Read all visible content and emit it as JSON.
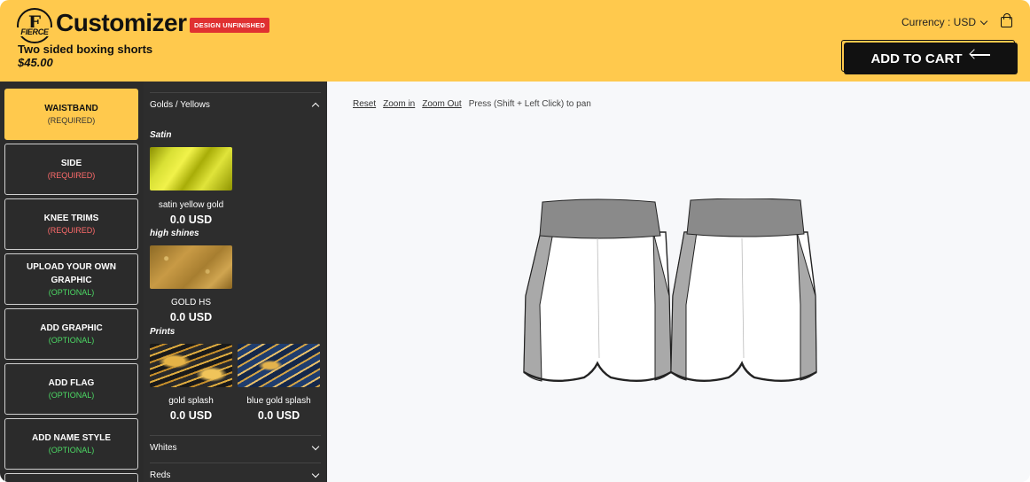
{
  "header": {
    "logo_text": "FIERCE",
    "title": "Customizer",
    "badge": "DESIGN UNFINISHED",
    "product_name": "Two sided boxing shorts",
    "price": "$45.00",
    "currency_label": "Currency : USD",
    "add_to_cart": "ADD TO CART",
    "accent_color": "#ffc94d"
  },
  "steps": [
    {
      "name": "WAISTBAND",
      "status": "(REQUIRED)",
      "active": true
    },
    {
      "name": "SIDE",
      "status": "(REQUIRED)",
      "active": false
    },
    {
      "name": "KNEE TRIMS",
      "status": "(REQUIRED)",
      "active": false
    },
    {
      "name": "UPLOAD YOUR OWN GRAPHIC",
      "status": "(OPTIONAL)",
      "active": false
    },
    {
      "name": "ADD GRAPHIC",
      "status": "(OPTIONAL)",
      "active": false
    },
    {
      "name": "ADD FLAG",
      "status": "(OPTIONAL)",
      "active": false
    },
    {
      "name": "ADD NAME STYLE",
      "status": "(OPTIONAL)",
      "active": false
    }
  ],
  "palette": {
    "groups": [
      {
        "label": "Golds / Yellows",
        "expanded": true
      },
      {
        "label": "Whites",
        "expanded": false
      },
      {
        "label": "Reds",
        "expanded": false
      }
    ],
    "categories": {
      "satin": "Satin",
      "high_shines": "high shines",
      "prints": "Prints"
    },
    "swatches": [
      {
        "name": "satin yellow gold",
        "price": "0.0 USD"
      },
      {
        "name": "GOLD HS",
        "price": "0.0 USD"
      },
      {
        "name": "gold splash",
        "price": "0.0 USD"
      },
      {
        "name": "blue gold splash",
        "price": "0.0 USD"
      }
    ]
  },
  "canvas": {
    "reset": "Reset",
    "zoom_in": "Zoom in",
    "zoom_out": "Zoom Out",
    "hint": "Press (Shift + Left Click) to pan"
  },
  "icons": {
    "bag": "shopping-bag-icon",
    "arrow": "arrow-left-icon",
    "chevron": "chevron-down-icon"
  }
}
